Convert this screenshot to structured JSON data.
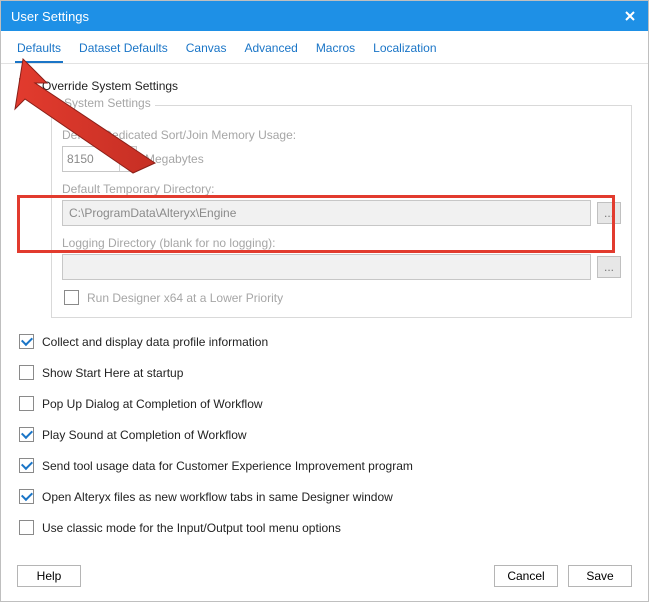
{
  "window": {
    "title": "User Settings"
  },
  "tabs": [
    {
      "label": "Defaults",
      "active": true
    },
    {
      "label": "Dataset Defaults"
    },
    {
      "label": "Canvas"
    },
    {
      "label": "Advanced"
    },
    {
      "label": "Macros"
    },
    {
      "label": "Localization"
    }
  ],
  "override": {
    "label": "Override System Settings",
    "checked": false
  },
  "panel": {
    "title": "System Settings",
    "mem_label": "Default Dedicated Sort/Join Memory Usage:",
    "mem_value": "8150",
    "mem_unit": "Megabytes",
    "temp_dir_label": "Default Temporary Directory:",
    "temp_dir_value": "C:\\ProgramData\\Alteryx\\Engine",
    "log_dir_label": "Logging Directory (blank for no logging):",
    "log_dir_value": "",
    "run_low_priority_label": "Run Designer x64 at a Lower Priority",
    "run_low_priority_checked": false,
    "browse_btn": "..."
  },
  "options": [
    {
      "label": "Collect and display data profile information",
      "checked": true
    },
    {
      "label": "Show Start Here at startup",
      "checked": false
    },
    {
      "label": "Pop Up Dialog at Completion of Workflow",
      "checked": false
    },
    {
      "label": "Play Sound at Completion of Workflow",
      "checked": true
    },
    {
      "label": "Send tool usage data for Customer Experience Improvement program",
      "checked": true
    },
    {
      "label": "Open Alteryx files as new workflow tabs in same Designer window",
      "checked": true
    },
    {
      "label": "Use classic mode for the Input/Output tool menu options",
      "checked": false
    }
  ],
  "footer": {
    "help": "Help",
    "cancel": "Cancel",
    "save": "Save"
  }
}
